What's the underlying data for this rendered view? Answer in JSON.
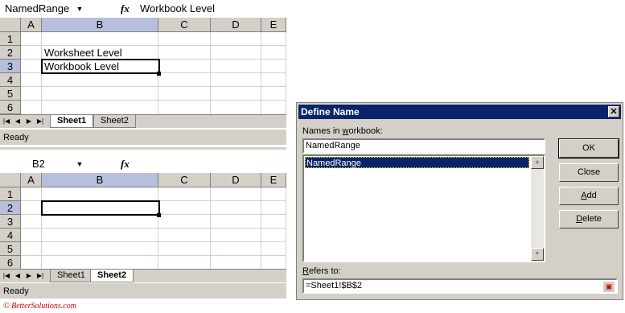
{
  "top_window": {
    "name_box": "NamedRange",
    "formula": "Workbook Level",
    "columns": [
      "",
      "A",
      "B",
      "C",
      "D",
      "E"
    ],
    "rows": [
      "1",
      "2",
      "3",
      "4",
      "5",
      "6"
    ],
    "cells": {
      "B2": "Worksheet Level",
      "B3": "Workbook Level"
    },
    "tabs": [
      "Sheet1",
      "Sheet2"
    ],
    "status": "Ready"
  },
  "bottom_window": {
    "name_box": "B2",
    "formula": "",
    "columns": [
      "",
      "A",
      "B",
      "C",
      "D",
      "E"
    ],
    "rows": [
      "1",
      "2",
      "3",
      "4",
      "5",
      "6"
    ],
    "tabs": [
      "Sheet1",
      "Sheet2"
    ],
    "status": "Ready"
  },
  "dialog": {
    "title": "Define Name",
    "close_glyph": "✕",
    "names_label_pre": "Names in ",
    "names_label_ul": "w",
    "names_label_post": "orkbook:",
    "name_input": "NamedRange",
    "names": [
      "NamedRange"
    ],
    "ok_label": "OK",
    "close_label": "Close",
    "add_label_ul": "A",
    "add_label_post": "dd",
    "delete_label_ul": "D",
    "delete_label_post": "elete",
    "refers_label_ul": "R",
    "refers_label_post": "efers to:",
    "refers_value": "=Sheet1!$B$2"
  },
  "credit": "© BetterSolutions.com",
  "colors": {
    "titlebar": "#0a246a",
    "face": "#d4d0c8",
    "selected_header": "#b6c0dc"
  }
}
